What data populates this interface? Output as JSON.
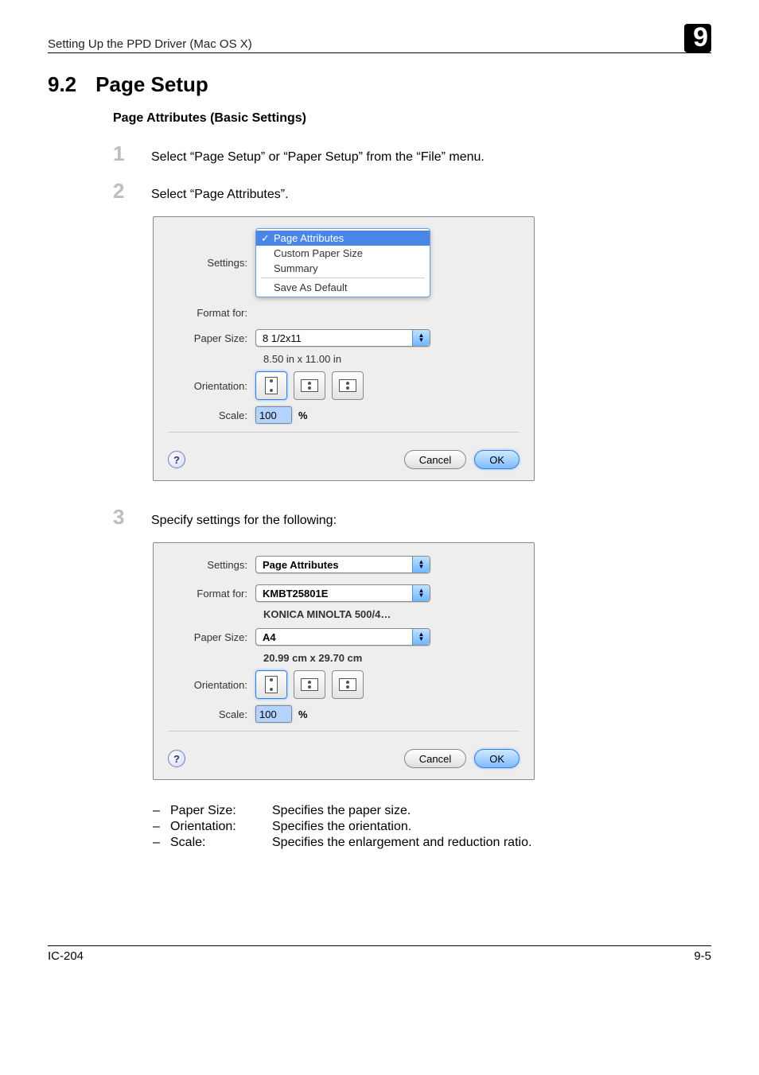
{
  "header": {
    "title": "Setting Up the PPD Driver (Mac OS X)",
    "chapter_num": "9"
  },
  "section": {
    "number": "9.2",
    "title": "Page Setup"
  },
  "subsection": {
    "title": "Page Attributes (Basic Settings)"
  },
  "steps": {
    "s1": {
      "num": "1",
      "text": "Select “Page Setup” or “Paper Setup” from the “File” menu."
    },
    "s2": {
      "num": "2",
      "text": "Select “Page Attributes”."
    },
    "s3": {
      "num": "3",
      "text": "Specify settings for the following:"
    }
  },
  "dialog1": {
    "labels": {
      "settings": "Settings:",
      "format_for": "Format for:",
      "paper_size": "Paper Size:",
      "orientation": "Orientation:",
      "scale": "Scale:"
    },
    "settings_menu": {
      "page_attributes": "Page Attributes",
      "custom_paper_size": "Custom Paper Size",
      "summary": "Summary",
      "save_as_default": "Save As Default"
    },
    "paper_size_value": "8 1/2x11",
    "paper_dim": "8.50 in x 11.00 in",
    "scale_value": "100",
    "pct": "%",
    "buttons": {
      "help": "?",
      "cancel": "Cancel",
      "ok": "OK"
    }
  },
  "dialog2": {
    "labels": {
      "settings": "Settings:",
      "format_for": "Format for:",
      "paper_size": "Paper Size:",
      "orientation": "Orientation:",
      "scale": "Scale:"
    },
    "settings_value": "Page Attributes",
    "format_for_value": "KMBT25801E",
    "format_for_sub": "KONICA MINOLTA 500/4…",
    "paper_size_value": "A4",
    "paper_dim": "20.99 cm x 29.70 cm",
    "scale_value": "100",
    "pct": "%",
    "buttons": {
      "help": "?",
      "cancel": "Cancel",
      "ok": "OK"
    }
  },
  "definitions": {
    "paper_size": {
      "term": "Paper Size:",
      "desc": "Specifies the paper size."
    },
    "orientation": {
      "term": "Orientation:",
      "desc": "Specifies the orientation."
    },
    "scale": {
      "term": "Scale:",
      "desc": "Specifies the enlargement and reduction ratio."
    }
  },
  "footer": {
    "left": "IC-204",
    "right": "9-5"
  }
}
